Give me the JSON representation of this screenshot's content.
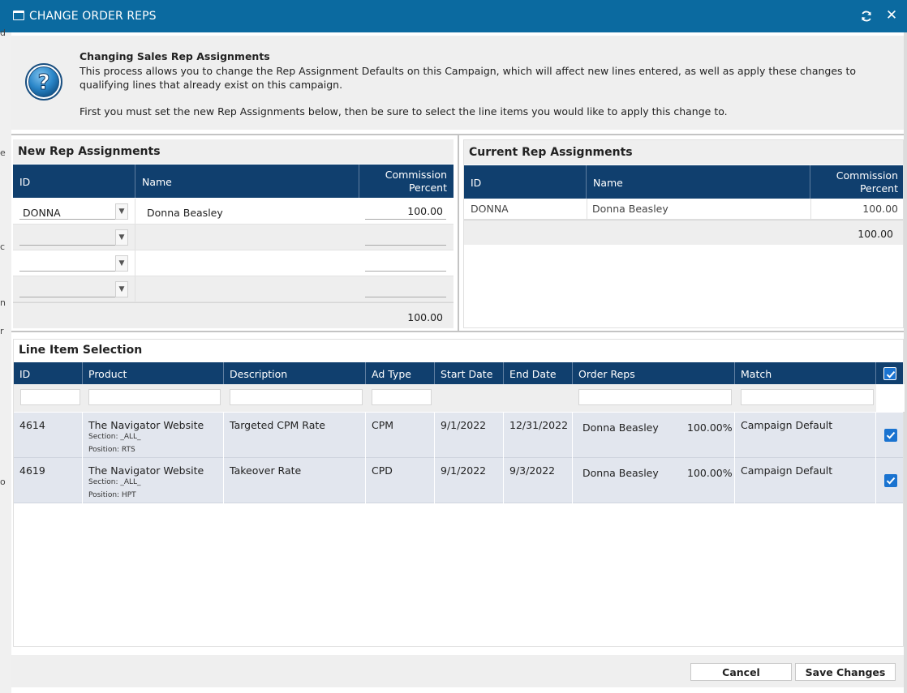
{
  "window": {
    "title": "CHANGE ORDER REPS"
  },
  "left_fragments": [
    "d",
    "e",
    "c",
    "n",
    "r",
    "o"
  ],
  "info": {
    "heading": "Changing Sales Rep Assignments",
    "line1": "This process allows you to change the Rep Assignment Defaults on this Campaign, which will affect new lines entered, as well as apply these changes to qualifying lines that already exist on this campaign.",
    "line2": "First you must set the new Rep Assignments below, then be sure to select the line items you would like to apply this change to."
  },
  "new_reps": {
    "title": "New Rep Assignments",
    "columns": {
      "id": "ID",
      "name": "Name",
      "pct_line1": "Commission",
      "pct_line2": "Percent"
    },
    "rows": [
      {
        "id": "DONNA",
        "name": "Donna Beasley",
        "pct": "100.00"
      },
      {
        "id": "",
        "name": "",
        "pct": ""
      },
      {
        "id": "",
        "name": "",
        "pct": ""
      },
      {
        "id": "",
        "name": "",
        "pct": ""
      }
    ],
    "total": "100.00"
  },
  "current_reps": {
    "title": "Current Rep Assignments",
    "columns": {
      "id": "ID",
      "name": "Name",
      "pct_line1": "Commission",
      "pct_line2": "Percent"
    },
    "rows": [
      {
        "id": "DONNA",
        "name": "Donna Beasley",
        "pct": "100.00"
      }
    ],
    "total": "100.00"
  },
  "line_items": {
    "title": "Line Item Selection",
    "columns": [
      "ID",
      "Product",
      "Description",
      "Ad Type",
      "Start Date",
      "End Date",
      "Order Reps",
      "Match"
    ],
    "rows": [
      {
        "id": "4614",
        "product": "The Navigator Website",
        "section": "Section: _ALL_",
        "position": "Position: RTS",
        "description": "Targeted CPM Rate",
        "ad_type": "CPM",
        "start": "9/1/2022",
        "end": "12/31/2022",
        "rep": "Donna Beasley",
        "rep_pct": "100.00%",
        "match": "Campaign Default",
        "checked": true
      },
      {
        "id": "4619",
        "product": "The Navigator Website",
        "section": "Section: _ALL_",
        "position": "Position: HPT",
        "description": "Takeover Rate",
        "ad_type": "CPD",
        "start": "9/1/2022",
        "end": "9/3/2022",
        "rep": "Donna Beasley",
        "rep_pct": "100.00%",
        "match": "Campaign Default",
        "checked": true
      }
    ]
  },
  "footer": {
    "cancel": "Cancel",
    "save": "Save Changes"
  },
  "colors": {
    "titlebar": "#0b6aa0",
    "grid_header": "#103f6e",
    "checkbox": "#1a73d0",
    "row_bg": "#e2e6ee"
  },
  "icons": [
    "window-icon",
    "refresh-icon",
    "close-icon",
    "help-icon",
    "chevron-down-icon",
    "check-icon"
  ]
}
